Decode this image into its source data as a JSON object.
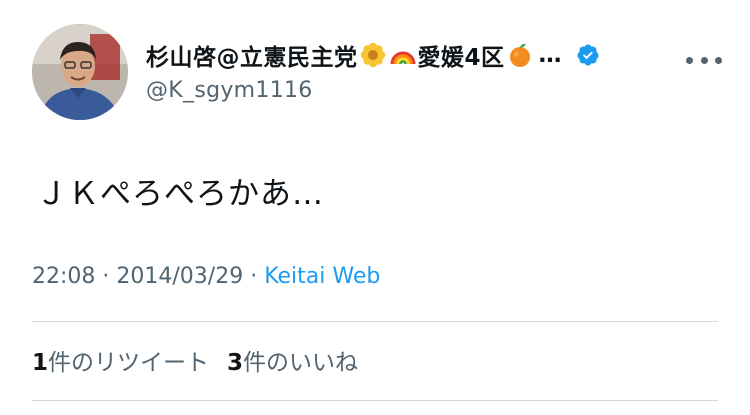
{
  "user": {
    "display_name": "杉山啓@立憲民主党",
    "name_suffix": "愛媛4区",
    "ellipsis": "…",
    "handle": "@K_sgym1116",
    "emoji": [
      "flower-icon",
      "rainbow-icon",
      "orange-icon"
    ]
  },
  "tweet": {
    "text": "ＪＫぺろぺろかあ…",
    "time": "22:08",
    "separator": " · ",
    "date": "2014/03/29",
    "source": "Keitai Web"
  },
  "stats": {
    "retweet_count": "1",
    "retweet_label": "件のリツイート",
    "like_count": "3",
    "like_label": "件のいいね"
  },
  "colors": {
    "text": "#0f1419",
    "secondary": "#536471",
    "link": "#1d9bf0",
    "verified": "#1d9bf0",
    "divider": "#cfd9de"
  }
}
